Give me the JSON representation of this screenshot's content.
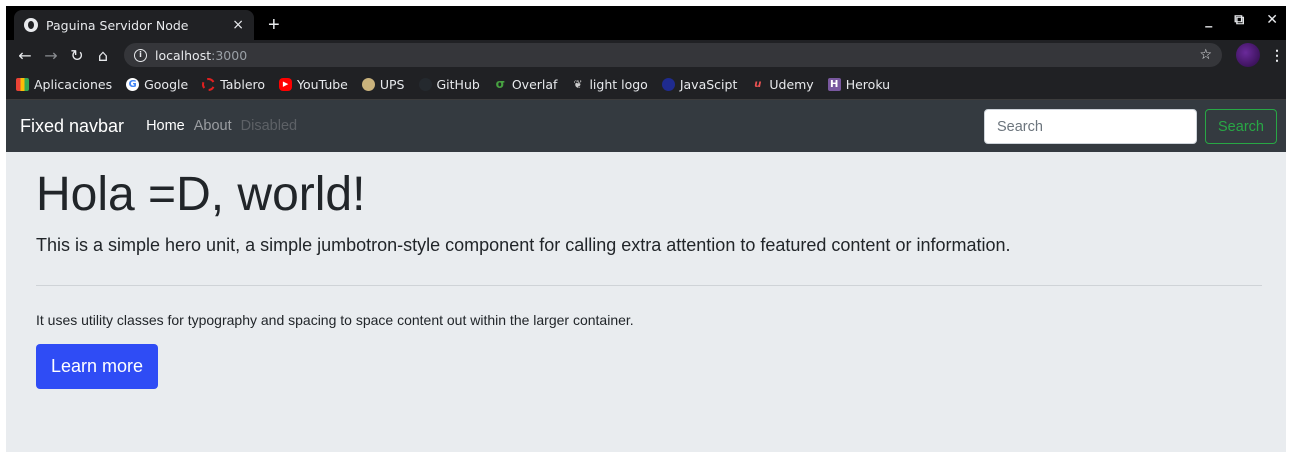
{
  "browser": {
    "tab_title": "Paguina Servidor Node",
    "tab_close": "×",
    "new_tab": "+",
    "window_controls": [
      "_",
      "⧉",
      "✕"
    ],
    "url_host": "localhost",
    "url_port": ":3000",
    "icons": [
      "back-icon",
      "forward-icon",
      "reload-icon",
      "home-icon",
      "info-icon",
      "star-icon",
      "menu-icon"
    ]
  },
  "bookmarks": [
    {
      "label": "Aplicaciones",
      "icon": "apps-grid-icon",
      "color": "#ea4335"
    },
    {
      "label": "Google",
      "icon": "google-icon",
      "color": "#ffffff"
    },
    {
      "label": "Tablero",
      "icon": "tablero-icon",
      "color": "#e02020"
    },
    {
      "label": "YouTube",
      "icon": "youtube-icon",
      "color": "#ff0000"
    },
    {
      "label": "UPS",
      "icon": "ups-icon",
      "color": "#c9b27c"
    },
    {
      "label": "GitHub",
      "icon": "github-icon",
      "color": "#24292e"
    },
    {
      "label": "Overlaf",
      "icon": "overleaf-icon",
      "color": "#47a141"
    },
    {
      "label": "light logo",
      "icon": "light-logo-icon",
      "color": "#cccccc"
    },
    {
      "label": "JavaScipt",
      "icon": "javascript-icon",
      "color": "#1f2b8f"
    },
    {
      "label": "Udemy",
      "icon": "udemy-icon",
      "color": "#ec5252"
    },
    {
      "label": "Heroku",
      "icon": "heroku-icon",
      "color": "#79589f"
    }
  ],
  "navbar": {
    "brand": "Fixed navbar",
    "links": [
      {
        "label": "Home",
        "state": "active"
      },
      {
        "label": "About",
        "state": "normal"
      },
      {
        "label": "Disabled",
        "state": "disabled"
      }
    ],
    "search_placeholder": "Search",
    "search_button": "Search",
    "bg_color": "#343a40",
    "success_color": "#28a745"
  },
  "jumbotron": {
    "heading": "Hola =D, world!",
    "lead": "This is a simple hero unit, a simple jumbotron-style component for calling extra attention to featured content or information.",
    "body": "It uses utility classes for typography and spacing to space content out within the larger container.",
    "button": "Learn more",
    "button_color": "#2f4cf5",
    "bg_color": "#e9ecef"
  }
}
